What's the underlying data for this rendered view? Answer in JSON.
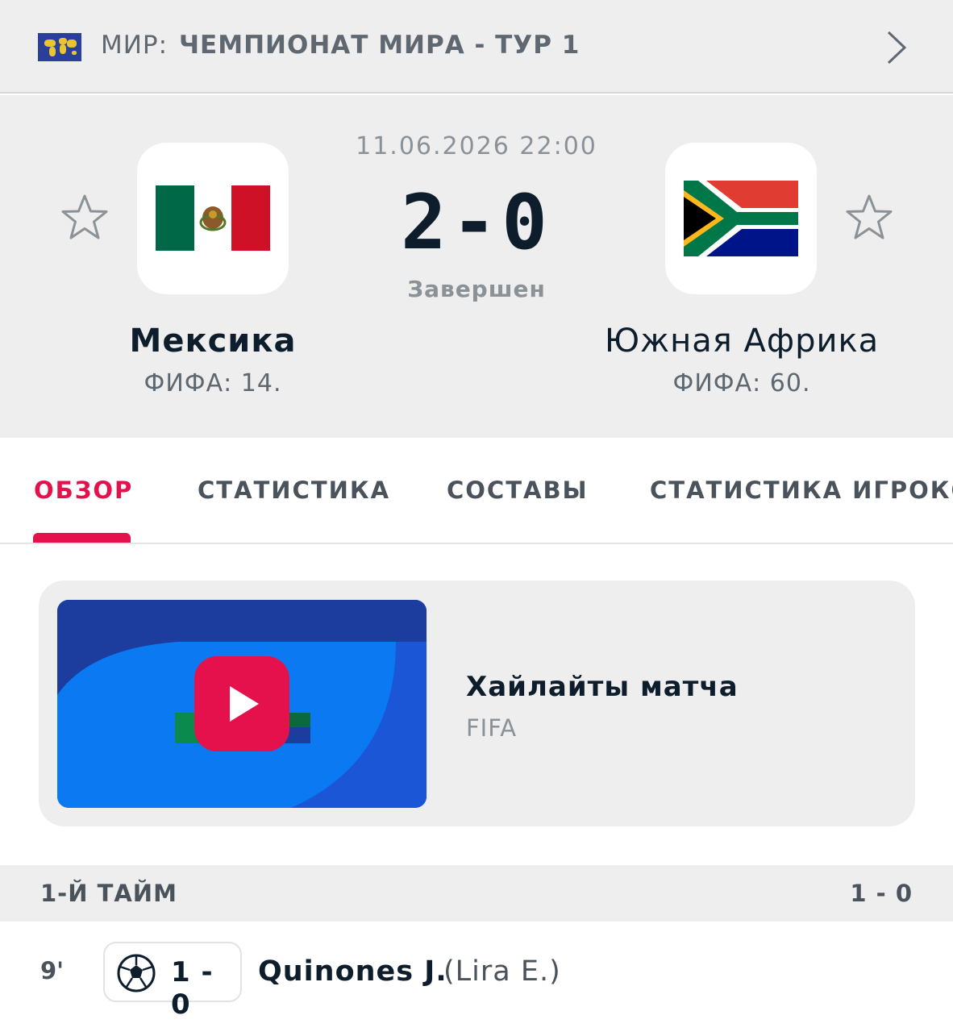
{
  "header": {
    "country_label": "МИР:",
    "league_label": "ЧЕМПИОНАТ МИРА - ТУР 1"
  },
  "match": {
    "datetime": "11.06.2026 22:00",
    "score": "2-0",
    "status": "Завершен",
    "home": {
      "name": "Мексика",
      "rank": "ФИФА: 14."
    },
    "away": {
      "name": "Южная Африка",
      "rank": "ФИФА: 60."
    }
  },
  "tabs": [
    {
      "label": "ОБЗОР",
      "active": true
    },
    {
      "label": "СТАТИСТИКА",
      "active": false
    },
    {
      "label": "СОСТАВЫ",
      "active": false
    },
    {
      "label": "СТАТИСТИКА ИГРОКО",
      "active": false
    }
  ],
  "highlight": {
    "title": "Хайлайты матча",
    "source": "FIFA"
  },
  "period": {
    "label": "1-Й ТАЙМ",
    "score": "1 - 0"
  },
  "event": {
    "minute": "9'",
    "score": "1 - 0",
    "player": "Quinones J.",
    "assist": "(Lira E.)"
  },
  "colors": {
    "accent": "#e4114d",
    "header_bg": "#eeeeee",
    "text_dark": "#0d1d2b",
    "text_muted": "#8a9197"
  }
}
